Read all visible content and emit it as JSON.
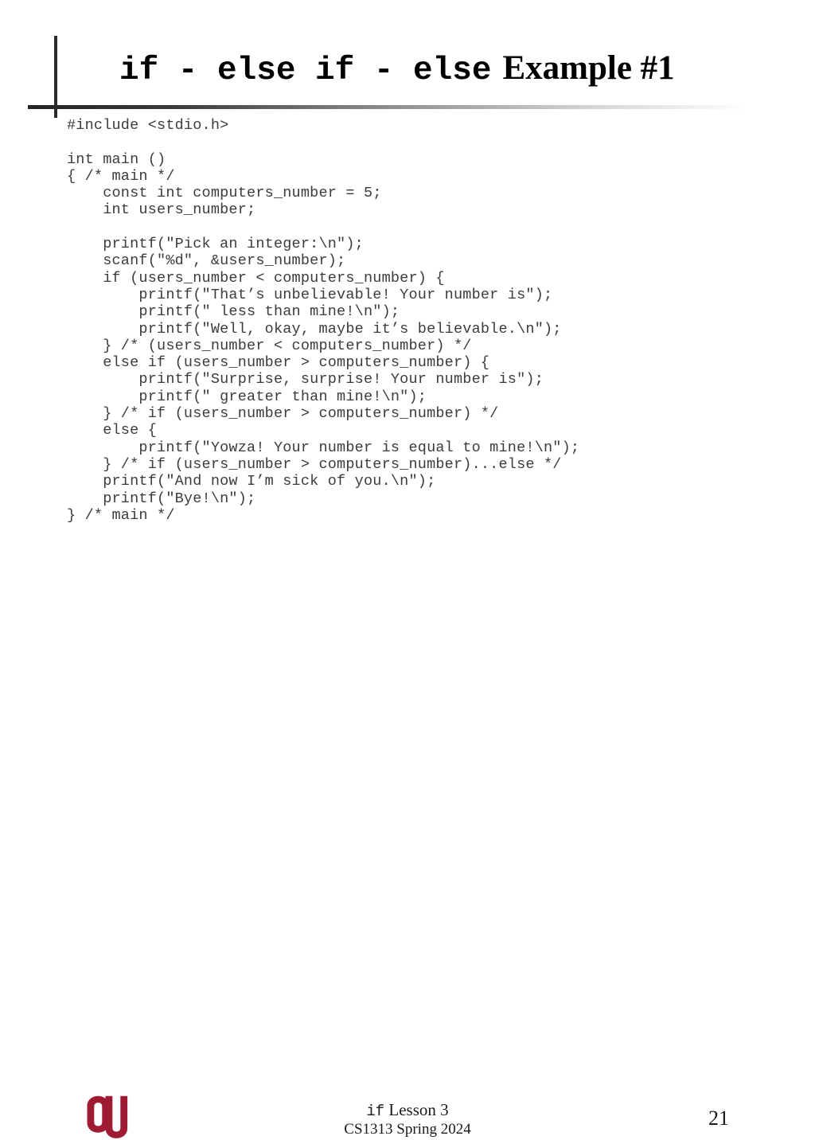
{
  "slide": {
    "title_mono": "if - else if - else",
    "title_serif": "Example #1",
    "page_number": "21"
  },
  "code": {
    "language": "c",
    "lines": [
      "#include <stdio.h>",
      "",
      "int main ()",
      "{ /* main */",
      "    const int computers_number = 5;",
      "    int users_number;",
      "",
      "    printf(\"Pick an integer:\\n\");",
      "    scanf(\"%d\", &users_number);",
      "    if (users_number < computers_number) {",
      "        printf(\"That’s unbelievable! Your number is\");",
      "        printf(\" less than mine!\\n\");",
      "        printf(\"Well, okay, maybe it’s believable.\\n\");",
      "    } /* (users_number < computers_number) */",
      "    else if (users_number > computers_number) {",
      "        printf(\"Surprise, surprise! Your number is\");",
      "        printf(\" greater than mine!\\n\");",
      "    } /* if (users_number > computers_number) */",
      "    else {",
      "        printf(\"Yowza! Your number is equal to mine!\\n\");",
      "    } /* if (users_number > computers_number)...else */",
      "    printf(\"And now I’m sick of you.\\n\");",
      "    printf(\"Bye!\\n\");",
      "} /* main */"
    ]
  },
  "footer": {
    "lesson_mono": "if",
    "lesson_serif": " Lesson 3",
    "course": "CS1313 Spring 2024",
    "logo_name": "ou-logo",
    "logo_color": "#9E1B32"
  }
}
